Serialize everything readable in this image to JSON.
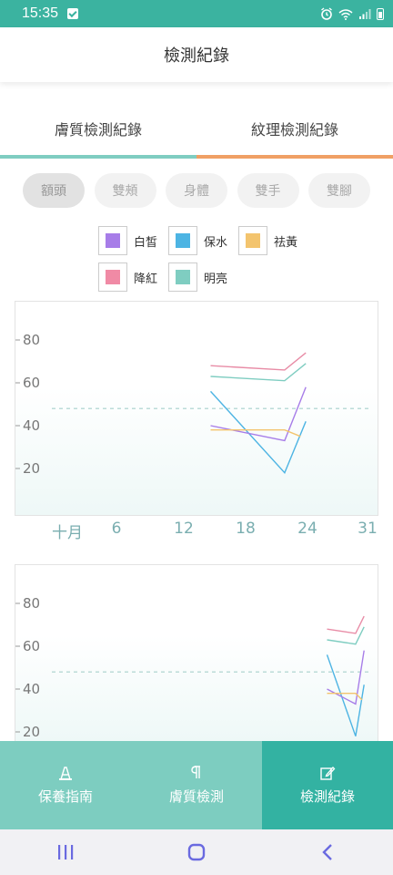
{
  "status_bar": {
    "time": "15:35"
  },
  "header": {
    "title": "檢測紀錄"
  },
  "tabs": [
    {
      "label": "膚質檢測紀錄",
      "color": "#7fcdc1"
    },
    {
      "label": "紋理檢測紀錄",
      "color": "#f0a065"
    }
  ],
  "chips": [
    {
      "label": "額頭",
      "active": true
    },
    {
      "label": "雙頰",
      "active": false
    },
    {
      "label": "身體",
      "active": false
    },
    {
      "label": "雙手",
      "active": false
    },
    {
      "label": "雙腳",
      "active": false
    }
  ],
  "legend": [
    {
      "label": "白皙",
      "color": "#a77de8"
    },
    {
      "label": "保水",
      "color": "#4db4e3"
    },
    {
      "label": "祛黃",
      "color": "#f3c46e"
    },
    {
      "label": "降紅",
      "color": "#f08aa5"
    },
    {
      "label": "明亮",
      "color": "#7fcdc1"
    }
  ],
  "chart_data": [
    {
      "type": "line",
      "x_ticks": [
        "十月",
        "6",
        "12",
        "18",
        "24",
        "31"
      ],
      "y_ticks": [
        "80",
        "60",
        "40",
        "20"
      ],
      "reference_line": 48,
      "series": [
        {
          "name": "降紅",
          "color": "#e88ca6",
          "points": [
            [
              16,
              68
            ],
            [
              23,
              66
            ],
            [
              25,
              74
            ]
          ]
        },
        {
          "name": "明亮",
          "color": "#7fcdc1",
          "points": [
            [
              16,
              63
            ],
            [
              23,
              61
            ],
            [
              25,
              69
            ]
          ]
        },
        {
          "name": "保水",
          "color": "#4db4e3",
          "points": [
            [
              16,
              56
            ],
            [
              23,
              18
            ],
            [
              25,
              42
            ]
          ]
        },
        {
          "name": "白皙",
          "color": "#a77de8",
          "points": [
            [
              16,
              40
            ],
            [
              23,
              33
            ],
            [
              25,
              58
            ]
          ]
        },
        {
          "name": "祛黃",
          "color": "#f3c46e",
          "points": [
            [
              16,
              38
            ],
            [
              23,
              38
            ],
            [
              24.5,
              35
            ]
          ]
        }
      ]
    },
    {
      "type": "line",
      "y_ticks": [
        "80",
        "60",
        "40",
        "20"
      ],
      "reference_line": 48,
      "series": [
        {
          "name": "降紅",
          "color": "#e88ca6",
          "points": [
            [
              27,
              68
            ],
            [
              29.7,
              66
            ],
            [
              30.5,
              74
            ]
          ]
        },
        {
          "name": "明亮",
          "color": "#7fcdc1",
          "points": [
            [
              27,
              63
            ],
            [
              29.7,
              61
            ],
            [
              30.5,
              69
            ]
          ]
        },
        {
          "name": "保水",
          "color": "#4db4e3",
          "points": [
            [
              27,
              56
            ],
            [
              29.7,
              18
            ],
            [
              30.5,
              42
            ]
          ]
        },
        {
          "name": "白皙",
          "color": "#a77de8",
          "points": [
            [
              27,
              40
            ],
            [
              29.7,
              33
            ],
            [
              30.5,
              58
            ]
          ]
        },
        {
          "name": "祛黃",
          "color": "#f3c46e",
          "points": [
            [
              27,
              38
            ],
            [
              29.7,
              38
            ],
            [
              30.3,
              35
            ]
          ]
        }
      ]
    }
  ],
  "bottom_nav": [
    {
      "label": "保養指南",
      "icon": "care-guide-icon",
      "active": false
    },
    {
      "label": "膚質檢測",
      "icon": "skin-test-icon",
      "active": false
    },
    {
      "label": "檢測紀錄",
      "icon": "record-edit-icon",
      "active": true
    }
  ]
}
